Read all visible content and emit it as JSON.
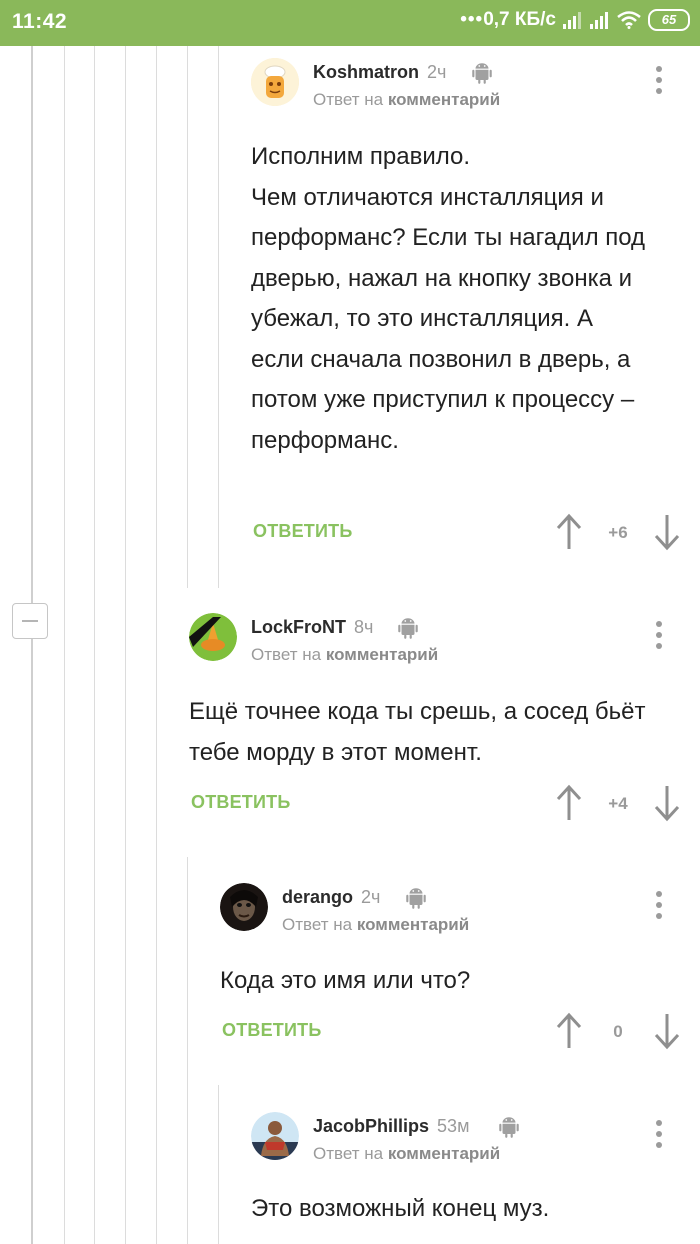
{
  "status": {
    "time": "11:42",
    "network": "0,7 КБ/с",
    "battery": "65"
  },
  "comments": [
    {
      "author": "Koshmatron",
      "time": "2ч",
      "reply_prefix": "Ответ на",
      "reply_target": "комментарий",
      "text": "Исполним правило.\nЧем отличаются инсталляция и перформанс? Если ты нагадил под дверью, нажал на кнопку звонка и убежал, то это инсталляция. А если сначала позвонил в дверь, а потом уже приступил к процессу – перформанс.",
      "reply_label": "ОТВЕТИТЬ",
      "score": "+6"
    },
    {
      "author": "LockFroNT",
      "time": "8ч",
      "reply_prefix": "Ответ на",
      "reply_target": "комментарий",
      "text": "Ещё точнее кода ты срешь, а сосед бьёт тебе морду в этот момент.",
      "reply_label": "ОТВЕТИТЬ",
      "score": "+4"
    },
    {
      "author": "derango",
      "time": "2ч",
      "reply_prefix": "Ответ на",
      "reply_target": "комментарий",
      "text": "Кода это имя или что?",
      "reply_label": "ОТВЕТИТЬ",
      "score": "0"
    },
    {
      "author": "JacobPhillips",
      "time": "53м",
      "reply_prefix": "Ответ на",
      "reply_target": "комментарий",
      "text": "Это возможный конец муз.",
      "reply_label": "",
      "score": ""
    }
  ],
  "colors": {
    "accent": "#8ab85a",
    "reply": "#8ac260",
    "muted": "#9a9a9a",
    "line": "#dcdcdc"
  },
  "icons": [
    "android-icon",
    "more-vert-icon",
    "upvote-arrow-icon",
    "downvote-arrow-icon",
    "collapse-thread-icon"
  ]
}
